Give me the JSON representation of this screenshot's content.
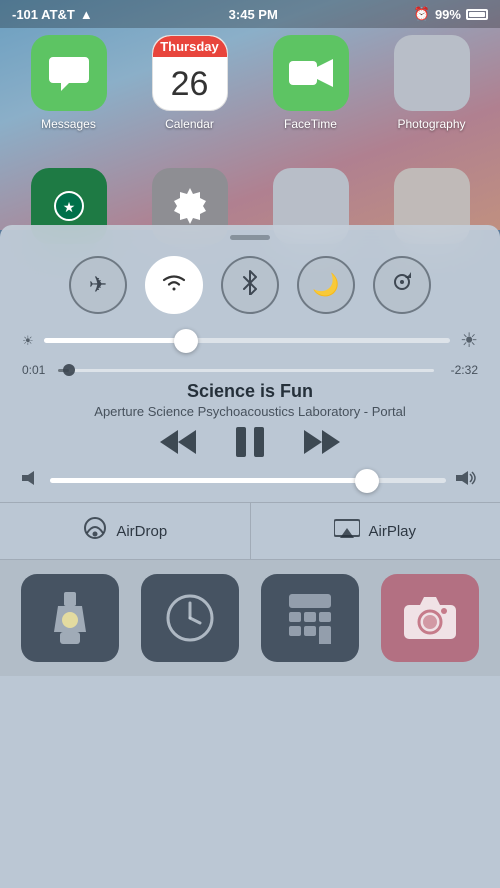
{
  "statusBar": {
    "carrier": "-101 AT&T",
    "time": "3:45 PM",
    "alarmIcon": "⏰",
    "battery": "99%"
  },
  "homeScreen": {
    "apps": [
      {
        "id": "messages",
        "label": "Messages",
        "icon": "messages"
      },
      {
        "id": "calendar",
        "label": "Calendar",
        "icon": "calendar",
        "day": "Thursday",
        "date": "26"
      },
      {
        "id": "facetime",
        "label": "FaceTime",
        "icon": "facetime"
      },
      {
        "id": "photography",
        "label": "Photography",
        "icon": "photography"
      }
    ]
  },
  "controlCenter": {
    "dragHandle": true,
    "toggles": [
      {
        "id": "airplane",
        "label": "Airplane Mode",
        "icon": "✈",
        "active": false
      },
      {
        "id": "wifi",
        "label": "Wi-Fi",
        "icon": "wifi",
        "active": true
      },
      {
        "id": "bluetooth",
        "label": "Bluetooth",
        "icon": "bluetooth",
        "active": false
      },
      {
        "id": "donotdisturb",
        "label": "Do Not Disturb",
        "icon": "moon",
        "active": false
      },
      {
        "id": "rotation",
        "label": "Rotation Lock",
        "icon": "rotation",
        "active": false
      }
    ],
    "brightness": {
      "value": 35,
      "minIcon": "☀",
      "maxIcon": "☀"
    },
    "media": {
      "currentTime": "0:01",
      "totalTime": "-2:32",
      "progressPercent": 3,
      "title": "Science is Fun",
      "artist": "Aperture Science Psychoacoustics Laboratory - Portal"
    },
    "volume": {
      "value": 80,
      "minIcon": "🔇",
      "maxIcon": "🔊"
    },
    "airDrop": {
      "label": "AirDrop",
      "icon": "airdrop"
    },
    "airPlay": {
      "label": "AirPlay",
      "icon": "airplay"
    },
    "quickActions": [
      {
        "id": "flashlight",
        "label": "Flashlight",
        "icon": "flashlight"
      },
      {
        "id": "clock",
        "label": "Clock",
        "icon": "clock"
      },
      {
        "id": "calculator",
        "label": "Calculator",
        "icon": "calculator"
      },
      {
        "id": "camera",
        "label": "Camera",
        "icon": "camera"
      }
    ]
  }
}
